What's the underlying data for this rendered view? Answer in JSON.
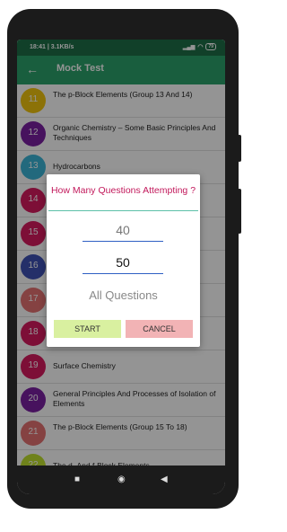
{
  "status_bar": {
    "time": "18:41 | 3.1KB/s",
    "battery": "79"
  },
  "app_bar": {
    "title": "Mock Test",
    "back_icon": "arrow-back-icon"
  },
  "list": [
    {
      "num": "11",
      "color": "#f1c40f",
      "label": "The p-Block Elements (Group 13 And 14)"
    },
    {
      "num": "12",
      "color": "#7b1fa2",
      "label": "Organic Chemistry – Some Basic Principles And Techniques"
    },
    {
      "num": "13",
      "color": "#3bb6d8",
      "label": "Hydrocarbons"
    },
    {
      "num": "14",
      "color": "#d81b60",
      "label": ""
    },
    {
      "num": "15",
      "color": "#d81b60",
      "label": ""
    },
    {
      "num": "16",
      "color": "#3f51b5",
      "label": ""
    },
    {
      "num": "17",
      "color": "#e57373",
      "label": ""
    },
    {
      "num": "18",
      "color": "#d81b60",
      "label": ""
    },
    {
      "num": "19",
      "color": "#d81b60",
      "label": "Surface Chemistry"
    },
    {
      "num": "20",
      "color": "#7b1fa2",
      "label": "General Principles And Processes of Isolation of Elements"
    },
    {
      "num": "21",
      "color": "#e57373",
      "label": "The p-Block Elements (Group 15 To 18)"
    },
    {
      "num": "22",
      "color": "#c0e030",
      "label": "The d- And f-Block Elements"
    }
  ],
  "dialog": {
    "title": "How Many Questions Attempting ?",
    "option_40": "40",
    "option_50": "50",
    "option_all": "All Questions",
    "start_label": "START",
    "cancel_label": "CANCEL"
  },
  "nav": {
    "square": "■",
    "circle": "◉",
    "back": "◀"
  }
}
